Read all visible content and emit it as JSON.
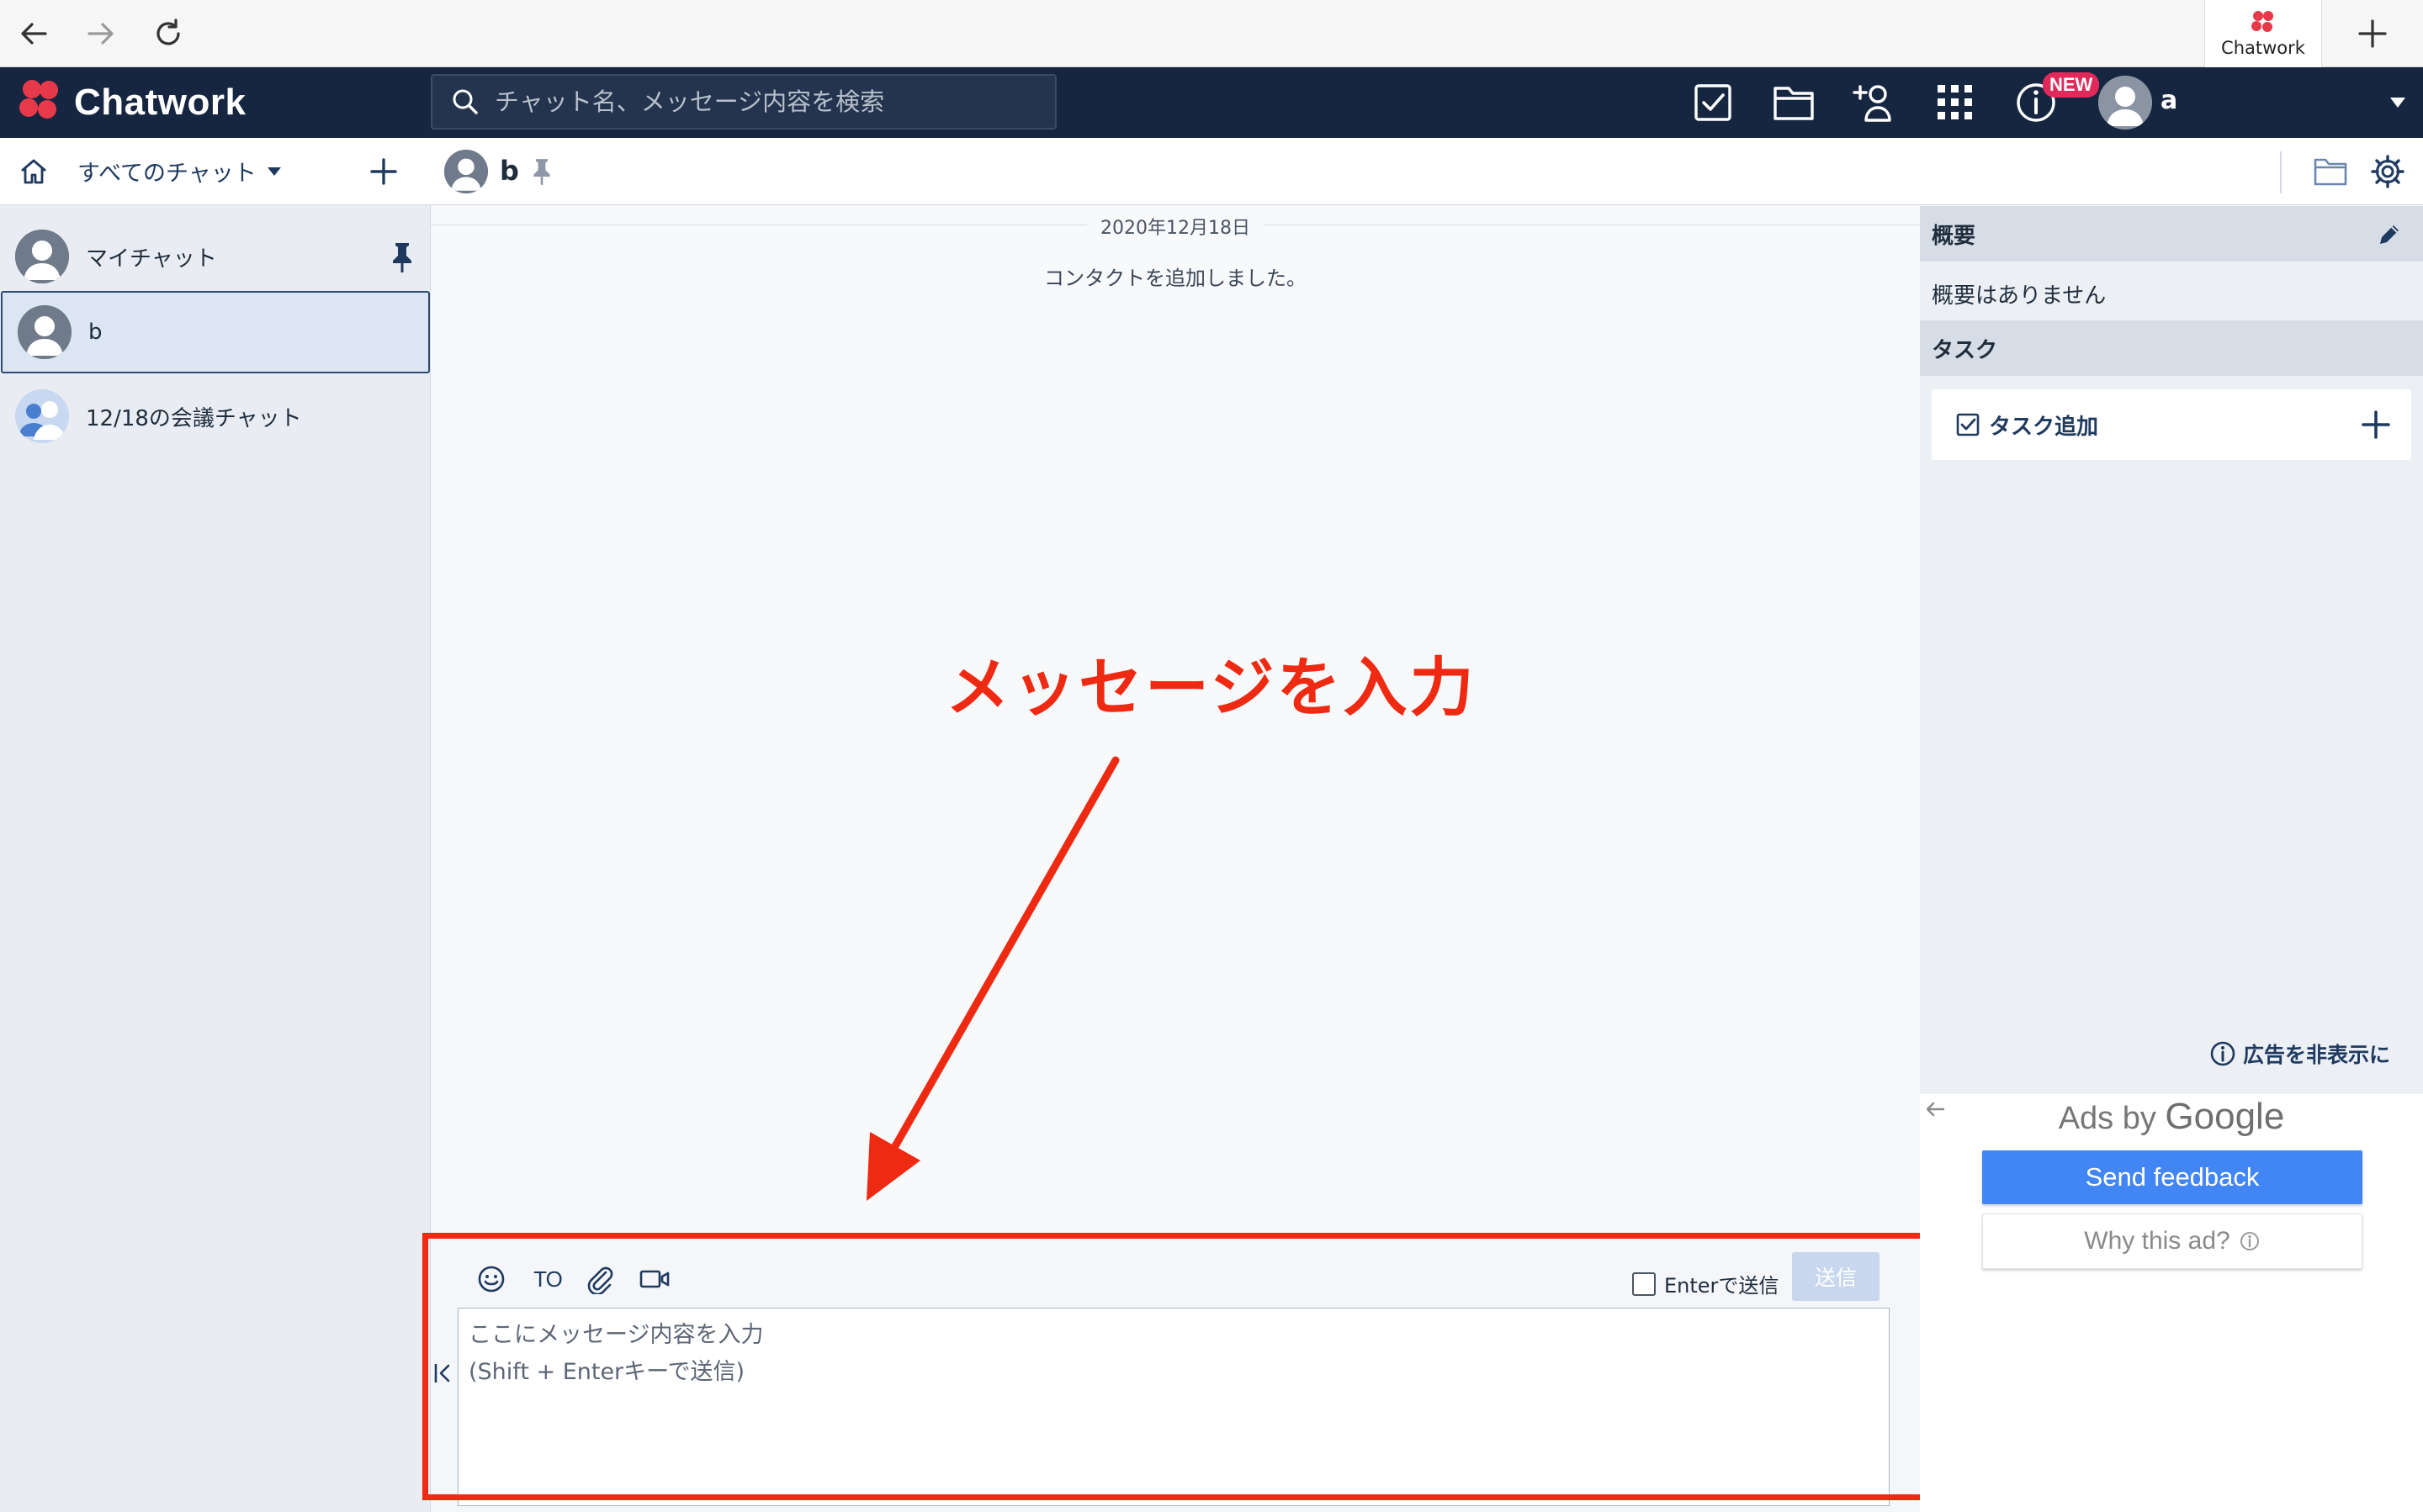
{
  "browser": {
    "tab_title": "Chatwork"
  },
  "header": {
    "brand": "Chatwork",
    "search_placeholder": "チャット名、メッセージ内容を検索",
    "new_badge": "NEW",
    "user_name": "a"
  },
  "sidebar": {
    "filter_label": "すべてのチャット",
    "rooms": [
      {
        "name": "マイチャット",
        "pinned": true
      },
      {
        "name": "b",
        "selected": true
      },
      {
        "name": "12/18の会議チャット"
      }
    ]
  },
  "room": {
    "title": "b",
    "date_separator": "2020年12月18日",
    "system_message": "コンタクトを追加しました。"
  },
  "annotation": {
    "text": "メッセージを入力"
  },
  "composer": {
    "to_label": "TO",
    "enter_send_label": "Enterで送信",
    "send_label": "送信",
    "placeholder": "ここにメッセージ内容を入力\n(Shift + Enterキーで送信)"
  },
  "right_panel": {
    "summary_title": "概要",
    "summary_body": "概要はありません",
    "tasks_title": "タスク",
    "task_add_label": "タスク追加",
    "hide_ads_label": "広告を非表示に"
  },
  "ads": {
    "ads_by": "Ads by",
    "google": "Google",
    "send_feedback": "Send feedback",
    "why_this_ad": "Why this ad?"
  },
  "colors": {
    "header_bg": "#162640",
    "annotation_red": "#ef2a12",
    "selected_room_bg": "#dce6f2",
    "google_blue": "#4285f4"
  },
  "icons": [
    "back-icon",
    "forward-icon",
    "reload-icon",
    "new-tab-icon",
    "search-icon",
    "task-icon",
    "folder-icon",
    "add-contact-icon",
    "apps-grid-icon",
    "info-icon",
    "chevron-down-icon",
    "home-icon",
    "plus-icon",
    "pin-icon",
    "gear-icon",
    "emoji-icon",
    "attach-icon",
    "video-icon",
    "edit-icon",
    "checkbox-icon"
  ]
}
